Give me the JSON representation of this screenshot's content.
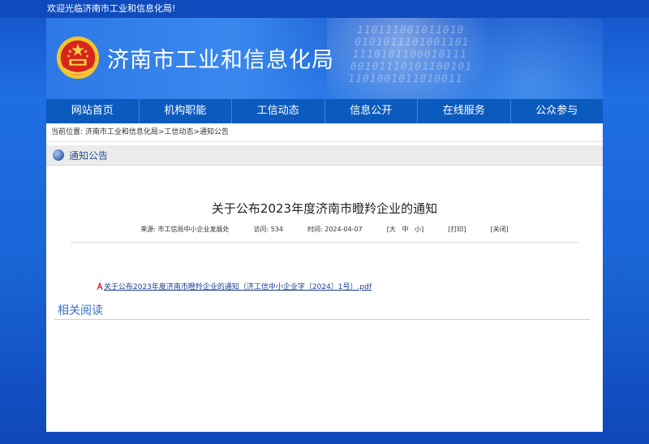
{
  "topbar": {
    "welcome": "欢迎光临济南市工业和信息化局!"
  },
  "banner": {
    "title": "济南市工业和信息化局",
    "binary_rows": [
      "110111001011010",
      "0101011101001101",
      "1110101100010111",
      "00101110101100101",
      "1101001011010011"
    ]
  },
  "nav": {
    "items": [
      "网站首页",
      "机构职能",
      "工信动态",
      "信息公开",
      "在线服务",
      "公众参与"
    ]
  },
  "breadcrumb": {
    "prefix": "当前位置:",
    "items": [
      "济南市工业和信息化局",
      "工信动态",
      "通知公告"
    ],
    "sep": ">"
  },
  "section": {
    "title": "通知公告"
  },
  "article": {
    "title": "关于公布2023年度济南市瞪羚企业的通知",
    "source": "来源: 市工信局中小企业发展处",
    "views": "访问: 534",
    "date": "时间: 2024-04-07",
    "size_open": "[大",
    "size_mid": "中",
    "size_close": "小]",
    "print": "[打印]",
    "close": "[关闭]",
    "attachment": "关于公布2023年度济南市瞪羚企业的通知（济工信中小企业字〔2024〕1号）.pdf"
  },
  "related": {
    "title": "相关阅读"
  },
  "colors": {
    "nav_bg": "#0b5bbf",
    "accent": "#3a6fc4",
    "link": "#1a3d8f"
  },
  "icons": {
    "emblem": "national-emblem-icon",
    "globe": "globe-icon",
    "pdf": "pdf-icon"
  }
}
